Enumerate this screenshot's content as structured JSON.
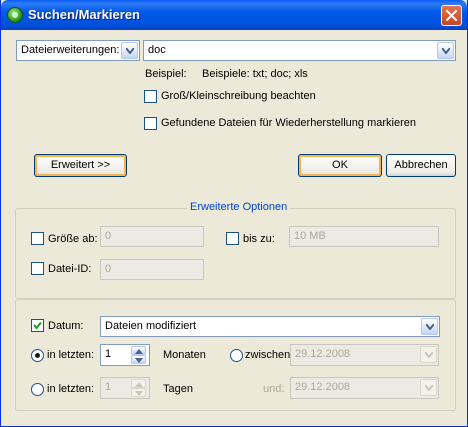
{
  "window": {
    "title": "Suchen/Markieren"
  },
  "search": {
    "type_value": "Dateierweiterungen:",
    "pattern_value": "doc",
    "example_label": "Beispiel:",
    "example_text": "Beispiele: txt; doc; xls",
    "case_label": "Groß/Kleinschreibung beachten",
    "mark_label": "Gefundene Dateien für Wiederherstellung markieren"
  },
  "buttons": {
    "advanced": "Erweitert >>",
    "ok": "OK",
    "cancel": "Abbrechen"
  },
  "advanced": {
    "title": "Erweiterte Optionen",
    "size_from_label": "Größe ab:",
    "size_from_value": "0",
    "size_to_label": "bis zu:",
    "size_to_value": "10 MB",
    "file_id_label": "Datei-ID:",
    "file_id_value": "0",
    "date_label": "Datum:",
    "date_mode_value": "Dateien modifiziert",
    "last_label_1": "in letzten:",
    "last_value_1": "1",
    "months_label": "Monaten",
    "between_label": "zwischen:",
    "date_from_value": "29.12.2008",
    "last_label_2": "in letzten:",
    "last_value_2": "1",
    "days_label": "Tagen",
    "and_label": "und:",
    "date_to_value": "29.12.2008"
  },
  "state": {
    "case_checked": false,
    "mark_checked": false,
    "size_from_checked": false,
    "size_to_checked": false,
    "file_id_checked": false,
    "date_checked": true,
    "last_months_selected": true,
    "between_selected": false,
    "last_days_selected": false
  }
}
